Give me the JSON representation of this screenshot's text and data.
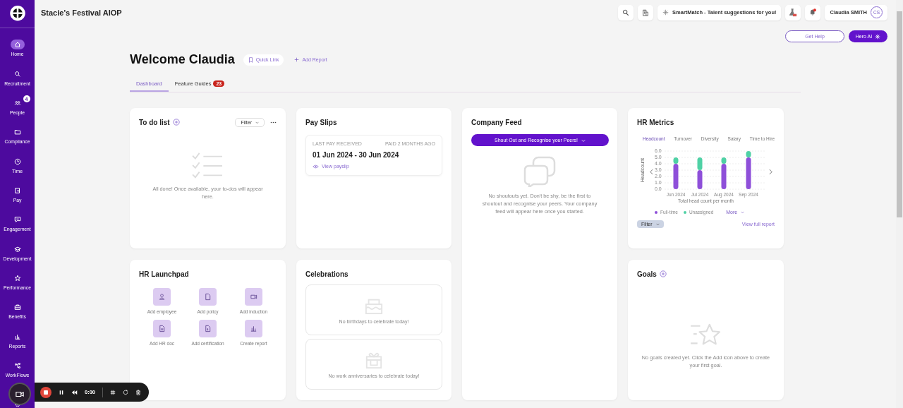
{
  "app": {
    "title": "Stacie's Festival AIOP"
  },
  "sidebar": {
    "items": [
      {
        "label": "Home",
        "selected": true
      },
      {
        "label": "Recruitment",
        "selected": false
      },
      {
        "label": "People",
        "selected": false,
        "badge": "4"
      },
      {
        "label": "Compliance",
        "selected": false
      },
      {
        "label": "Time",
        "selected": false
      },
      {
        "label": "Pay",
        "selected": false
      },
      {
        "label": "Engagement",
        "selected": false
      },
      {
        "label": "Development",
        "selected": false
      },
      {
        "label": "Performance",
        "selected": false
      },
      {
        "label": "Benefits",
        "selected": false
      },
      {
        "label": "Reports",
        "selected": false
      },
      {
        "label": "WorkFlows",
        "selected": false
      }
    ]
  },
  "topbar": {
    "smartmatch": "SmartMatch - Talent suggestions for you!",
    "user": {
      "name": "Claudia SMITH",
      "initials": "CS"
    }
  },
  "help_buttons": {
    "help": "Get Help",
    "ai": "Hero AI"
  },
  "heading": "Welcome Claudia",
  "actions": {
    "quick_link": "Quick Link",
    "add_report": "Add Report"
  },
  "tabs": [
    {
      "label": "Dashboard",
      "selected": true
    },
    {
      "label": "Feature Guides",
      "selected": false,
      "badge": "23"
    }
  ],
  "todo": {
    "title": "To do list",
    "filter": "Filter",
    "empty": "All done! Once available, your to-dos will appear here."
  },
  "pay_slips": {
    "title": "Pay Slips",
    "caption": "LAST PAY RECEIVED",
    "paid": "PAID 2 MONTHS AGO",
    "period": "01 Jun 2024 - 30 Jun 2024",
    "link": "View payslip"
  },
  "company_feed": {
    "title": "Company Feed",
    "button": "Shout Out and Recognise your Peers!",
    "empty": "No shoutouts yet. Don't be shy, be the first to shoutout and recognise your peers. Your company feed will appear here once you started."
  },
  "hr_metrics": {
    "title": "HR Metrics",
    "tabs": [
      {
        "label": "Headcount",
        "selected": true
      },
      {
        "label": "Turnover",
        "selected": false
      },
      {
        "label": "Diversity",
        "selected": false
      },
      {
        "label": "Salary",
        "selected": false
      },
      {
        "label": "Time to Hire",
        "selected": false
      }
    ],
    "chart_data": {
      "type": "bar",
      "stacked": true,
      "grid": true,
      "xlabel": "Total head count per month",
      "ylabel": "Headcount",
      "categories": [
        "Jun 2024",
        "Jul 2024",
        "Aug 2024",
        "Sep 2024"
      ],
      "series": [
        {
          "name": "Full-time",
          "color": "#8e4fd9",
          "values": [
            4,
            3,
            4,
            5
          ]
        },
        {
          "name": "Unassigned",
          "color": "#4fd1a5",
          "values": [
            1,
            2,
            1,
            1
          ]
        }
      ],
      "ylim": [
        0,
        6
      ],
      "yticks": [
        {
          "value": 0,
          "label": "0.0"
        },
        {
          "value": 1,
          "label": "1.0"
        },
        {
          "value": 2,
          "label": "2.0"
        },
        {
          "value": 3,
          "label": "3.0"
        },
        {
          "value": 4,
          "label": "4.0"
        },
        {
          "value": 5,
          "label": "5.0"
        },
        {
          "value": 6,
          "label": "6.0"
        }
      ]
    },
    "more": "More",
    "filter": "Filter",
    "link": "View full report"
  },
  "launchpad": {
    "title": "HR Launchpad",
    "items": [
      "Add employee",
      "Add policy",
      "Add induction",
      "Add HR doc",
      "Add certification",
      "Create report"
    ]
  },
  "celebrations": {
    "title": "Celebrations",
    "birthdays": "No birthdays to celebrate today!",
    "anniversaries": "No work anniversaries to celebrate today!"
  },
  "goals": {
    "title": "Goals",
    "empty": "No goals created yet. Click the Add icon above to create your first goal."
  },
  "recorder": {
    "time": "0:00"
  }
}
